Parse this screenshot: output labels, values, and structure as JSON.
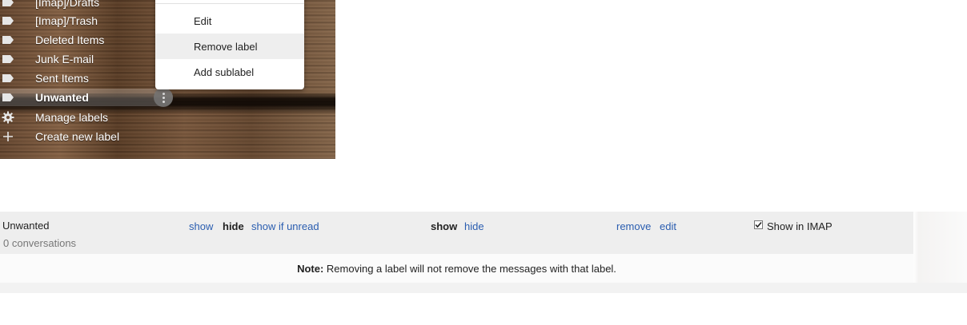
{
  "sidebar": {
    "items": [
      {
        "label": "[Imap]/Drafts",
        "icon": "label-icon"
      },
      {
        "label": "[Imap]/Trash",
        "icon": "label-icon"
      },
      {
        "label": "Deleted Items",
        "icon": "label-icon"
      },
      {
        "label": "Junk E-mail",
        "icon": "label-icon"
      },
      {
        "label": "Sent Items",
        "icon": "label-icon"
      },
      {
        "label": "Unwanted",
        "icon": "label-icon",
        "selected": true
      },
      {
        "label": "Manage labels",
        "icon": "gear-icon"
      },
      {
        "label": "Create new label",
        "icon": "plus-icon"
      }
    ]
  },
  "context_menu": {
    "items": [
      {
        "label": "Edit"
      },
      {
        "label": "Remove label",
        "hovered": true
      },
      {
        "label": "Add sublabel"
      }
    ]
  },
  "label_row": {
    "name": "Unwanted",
    "count": "0 conversations",
    "label_list": {
      "show": "show",
      "hide": "hide",
      "show_if_unread": "show if unread",
      "selected": "hide"
    },
    "message_list": {
      "show": "show",
      "hide": "hide",
      "selected": "show"
    },
    "actions": {
      "remove": "remove",
      "edit": "edit"
    },
    "imap": {
      "label": "Show in IMAP",
      "checked": true
    }
  },
  "note": {
    "prefix": "Note:",
    "text": " Removing a label will not remove the messages with that label."
  },
  "colors": {
    "link": "#2a5db0",
    "row_background": "#eeeeee",
    "text": "#222222"
  }
}
